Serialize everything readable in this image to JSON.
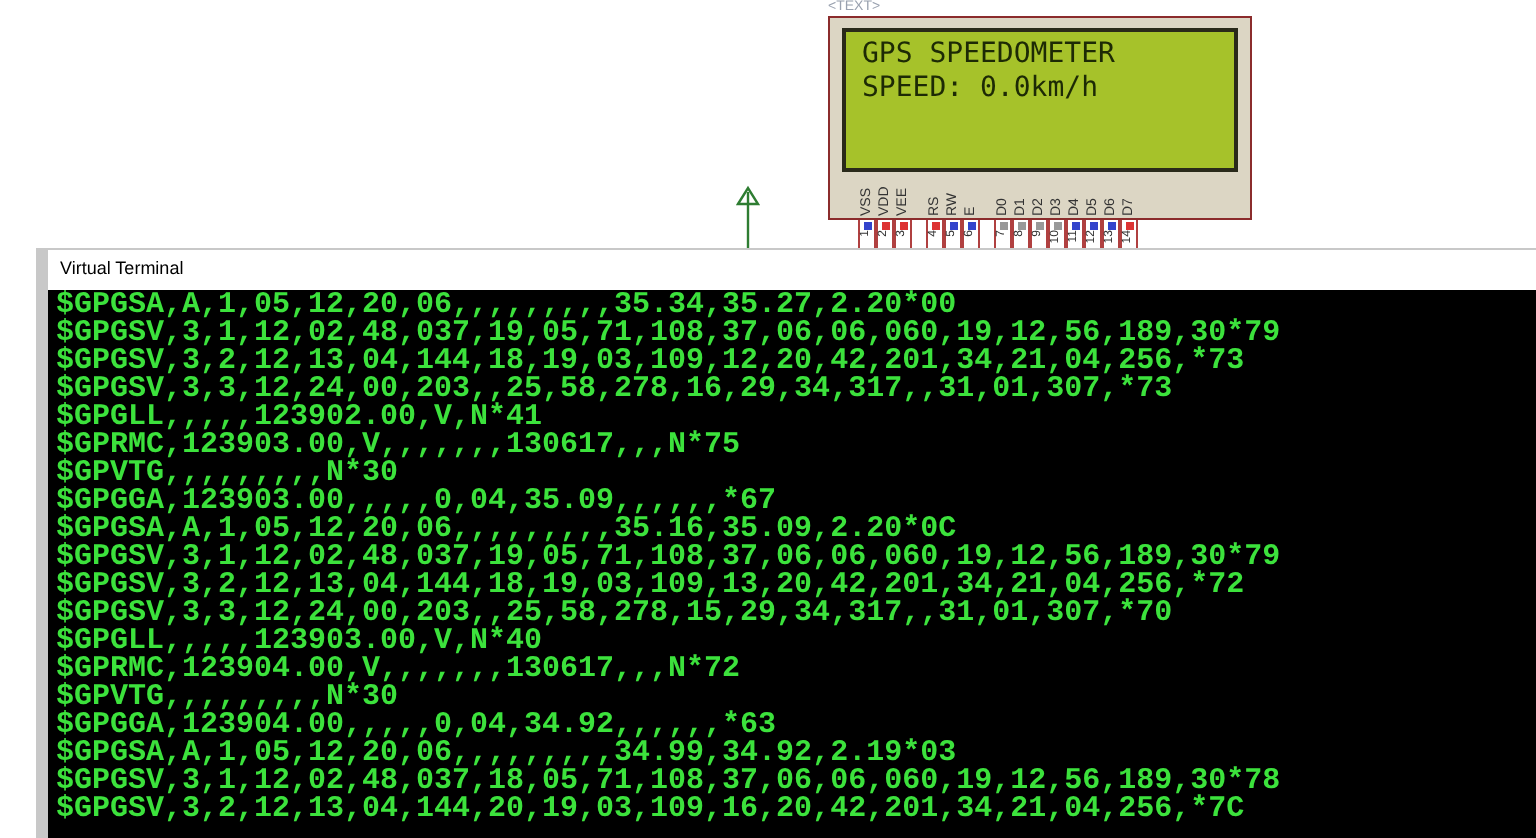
{
  "lcd": {
    "tag": "<TEXT>",
    "lines": [
      "GPS SPEEDOMETER",
      "SPEED: 0.0km/h"
    ],
    "pin_groups": [
      [
        {
          "label": "VSS",
          "number": "1",
          "color": "#3344cc"
        },
        {
          "label": "VDD",
          "number": "2",
          "color": "#dd3333"
        },
        {
          "label": "VEE",
          "number": "3",
          "color": "#dd3333"
        }
      ],
      [
        {
          "label": "RS",
          "number": "4",
          "color": "#dd3333"
        },
        {
          "label": "RW",
          "number": "5",
          "color": "#3344cc"
        },
        {
          "label": "E",
          "number": "6",
          "color": "#3344cc"
        }
      ],
      [
        {
          "label": "D0",
          "number": "7",
          "color": "#999999"
        },
        {
          "label": "D1",
          "number": "8",
          "color": "#999999"
        },
        {
          "label": "D2",
          "number": "9",
          "color": "#999999"
        },
        {
          "label": "D3",
          "number": "10",
          "color": "#999999"
        },
        {
          "label": "D4",
          "number": "11",
          "color": "#3344cc"
        },
        {
          "label": "D5",
          "number": "12",
          "color": "#3344cc"
        },
        {
          "label": "D6",
          "number": "13",
          "color": "#3344cc"
        },
        {
          "label": "D7",
          "number": "14",
          "color": "#dd3333"
        }
      ]
    ]
  },
  "terminal": {
    "title": "Virtual Terminal",
    "lines": [
      "$GPGSA,A,1,05,12,20,06,,,,,,,,,35.34,35.27,2.20*00",
      "$GPGSV,3,1,12,02,48,037,19,05,71,108,37,06,06,060,19,12,56,189,30*79",
      "$GPGSV,3,2,12,13,04,144,18,19,03,109,12,20,42,201,34,21,04,256,*73",
      "$GPGSV,3,3,12,24,00,203,,25,58,278,16,29,34,317,,31,01,307,*73",
      "$GPGLL,,,,,123902.00,V,N*41",
      "$GPRMC,123903.00,V,,,,,,,130617,,,N*75",
      "$GPVTG,,,,,,,,,N*30",
      "$GPGGA,123903.00,,,,,0,04,35.09,,,,,,*67",
      "$GPGSA,A,1,05,12,20,06,,,,,,,,,35.16,35.09,2.20*0C",
      "$GPGSV,3,1,12,02,48,037,19,05,71,108,37,06,06,060,19,12,56,189,30*79",
      "$GPGSV,3,2,12,13,04,144,18,19,03,109,13,20,42,201,34,21,04,256,*72",
      "$GPGSV,3,3,12,24,00,203,,25,58,278,15,29,34,317,,31,01,307,*70",
      "$GPGLL,,,,,123903.00,V,N*40",
      "$GPRMC,123904.00,V,,,,,,,130617,,,N*72",
      "$GPVTG,,,,,,,,,N*30",
      "$GPGGA,123904.00,,,,,0,04,34.92,,,,,,*63",
      "$GPGSA,A,1,05,12,20,06,,,,,,,,,34.99,34.92,2.19*03",
      "$GPGSV,3,1,12,02,48,037,18,05,71,108,37,06,06,060,19,12,56,189,30*78",
      "$GPGSV,3,2,12,13,04,144,20,19,03,109,16,20,42,201,34,21,04,256,*7C"
    ]
  }
}
